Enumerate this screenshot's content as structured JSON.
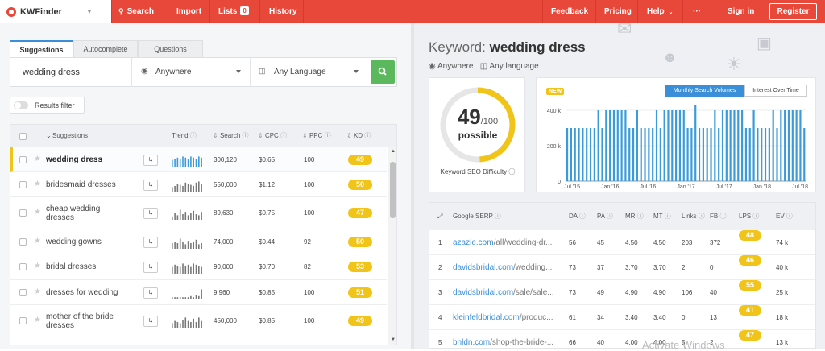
{
  "app": {
    "name": "KWFinder"
  },
  "nav": {
    "search": "Search",
    "import": "Import",
    "lists": "Lists",
    "lists_count": "0",
    "history": "History",
    "feedback": "Feedback",
    "pricing": "Pricing",
    "help": "Help",
    "more": "···",
    "signin": "Sign in",
    "register": "Register"
  },
  "tabs": [
    "Suggestions",
    "Autocomplete",
    "Questions"
  ],
  "search": {
    "keyword": "wedding dress",
    "location": "Anywhere",
    "language": "Any Language"
  },
  "filter": {
    "label": "Results filter"
  },
  "kw_table": {
    "headers": {
      "suggestions": "Suggestions",
      "trend": "Trend",
      "search": "Search",
      "cpc": "CPC",
      "ppc": "PPC",
      "kd": "KD"
    },
    "rows": [
      {
        "keyword": "wedding dress",
        "search": "300,120",
        "cpc": "$0.65",
        "ppc": "100",
        "kd": "49"
      },
      {
        "keyword": "bridesmaid dresses",
        "search": "550,000",
        "cpc": "$1.12",
        "ppc": "100",
        "kd": "50"
      },
      {
        "keyword": "cheap wedding dresses",
        "search": "89,630",
        "cpc": "$0.75",
        "ppc": "100",
        "kd": "47"
      },
      {
        "keyword": "wedding gowns",
        "search": "74,000",
        "cpc": "$0.44",
        "ppc": "92",
        "kd": "50"
      },
      {
        "keyword": "bridal dresses",
        "search": "90,000",
        "cpc": "$0.70",
        "ppc": "82",
        "kd": "53"
      },
      {
        "keyword": "dresses for wedding",
        "search": "9,960",
        "cpc": "$0.85",
        "ppc": "100",
        "kd": "51"
      },
      {
        "keyword": "mother of the bride dresses",
        "search": "450,000",
        "cpc": "$0.85",
        "ppc": "100",
        "kd": "49"
      }
    ]
  },
  "detail": {
    "keyword_label": "Keyword:",
    "keyword": "wedding dress",
    "location": "Anywhere",
    "language": "Any language",
    "difficulty_value": "49",
    "difficulty_max": "/100",
    "difficulty_word": "possible",
    "difficulty_caption": "Keyword SEO Difficulty",
    "difficulty_fraction": 0.49
  },
  "volume_chart": {
    "new_badge": "NEW",
    "toggle_active": "Monthly Search Volumes",
    "toggle_other": "Interest Over Time"
  },
  "chart_data": {
    "type": "bar",
    "ytick_labels": [
      "400 k",
      "200 k",
      "0"
    ],
    "xtick_labels": [
      "Jul '15",
      "Jan '16",
      "Jul '16",
      "Jan '17",
      "Jul '17",
      "Jan '18",
      "Jul '18"
    ],
    "ylim": [
      0,
      450000
    ],
    "values": [
      300000,
      300000,
      300000,
      300000,
      300000,
      300000,
      300000,
      300000,
      400000,
      300000,
      400000,
      400000,
      400000,
      400000,
      400000,
      400000,
      300000,
      300000,
      400000,
      300000,
      300000,
      300000,
      300000,
      400000,
      300000,
      400000,
      400000,
      400000,
      400000,
      400000,
      400000,
      300000,
      300000,
      430000,
      300000,
      300000,
      300000,
      300000,
      400000,
      300000,
      400000,
      400000,
      400000,
      400000,
      400000,
      400000,
      300000,
      300000,
      400000,
      300000,
      300000,
      300000,
      300000,
      400000,
      300000,
      400000,
      400000,
      400000,
      400000,
      400000,
      400000,
      300000
    ],
    "color": "#3b9ad9"
  },
  "serp": {
    "headers": {
      "serp": "Google SERP",
      "da": "DA",
      "pa": "PA",
      "mr": "MR",
      "mt": "MT",
      "links": "Links",
      "fb": "FB",
      "lps": "LPS",
      "ev": "EV"
    },
    "rows": [
      {
        "num": "1",
        "domain": "azazie.com",
        "path": "/all/wedding-dr...",
        "da": "56",
        "pa": "45",
        "mr": "4.50",
        "mt": "4.50",
        "links": "203",
        "fb": "372",
        "lps": "48",
        "ev": "74 k"
      },
      {
        "num": "2",
        "domain": "davidsbridal.com",
        "path": "/wedding...",
        "da": "73",
        "pa": "37",
        "mr": "3.70",
        "mt": "3.70",
        "links": "2",
        "fb": "0",
        "lps": "46",
        "ev": "40 k"
      },
      {
        "num": "3",
        "domain": "davidsbridal.com",
        "path": "/sale/sale...",
        "da": "73",
        "pa": "49",
        "mr": "4.90",
        "mt": "4.90",
        "links": "106",
        "fb": "40",
        "lps": "55",
        "ev": "25 k"
      },
      {
        "num": "4",
        "domain": "kleinfeldbridal.com",
        "path": "/produc...",
        "da": "61",
        "pa": "34",
        "mr": "3.40",
        "mt": "3.40",
        "links": "0",
        "fb": "13",
        "lps": "41",
        "ev": "18 k"
      },
      {
        "num": "5",
        "domain": "bhldn.com",
        "path": "/shop-the-bride-...",
        "da": "66",
        "pa": "40",
        "mr": "4.00",
        "mt": "4.00",
        "links": "5",
        "fb": "2",
        "lps": "47",
        "ev": "13 k"
      }
    ]
  },
  "watermark": "Activate Windows",
  "colors": {
    "brand": "#e8483a",
    "accent": "#3b8fd8",
    "score": "#f0c419",
    "go": "#5cb85c"
  }
}
